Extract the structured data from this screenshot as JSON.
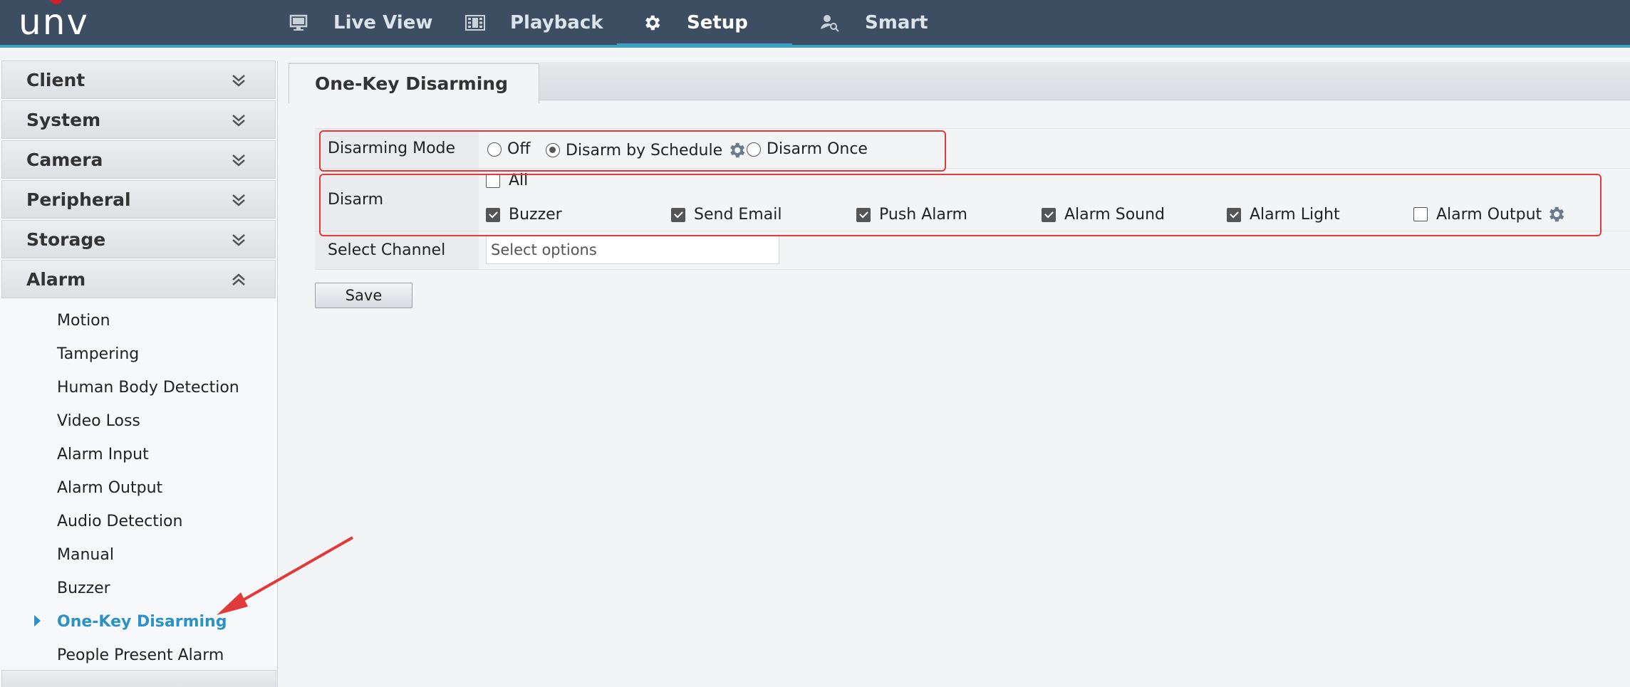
{
  "header": {
    "logo": "unv",
    "nav": [
      {
        "label": "Live View",
        "icon": "monitor-icon"
      },
      {
        "label": "Playback",
        "icon": "film-icon"
      },
      {
        "label": "Setup",
        "icon": "gear-icon",
        "active": true
      },
      {
        "label": "Smart",
        "icon": "user-search-icon"
      }
    ]
  },
  "sidebar": {
    "sections": [
      "Client",
      "System",
      "Camera",
      "Peripheral",
      "Storage"
    ],
    "alarm": {
      "label": "Alarm",
      "items": [
        "Motion",
        "Tampering",
        "Human Body Detection",
        "Video Loss",
        "Alarm Input",
        "Alarm Output",
        "Audio Detection",
        "Manual",
        "Buzzer",
        "One-Key Disarming",
        "People Present Alarm"
      ],
      "active_item": "One-Key Disarming"
    }
  },
  "main": {
    "tab": "One-Key Disarming",
    "disarming_mode": {
      "label": "Disarming Mode",
      "options": [
        "Off",
        "Disarm by Schedule",
        "Disarm Once"
      ],
      "selected": "Disarm by Schedule"
    },
    "disarm": {
      "label": "Disarm",
      "all_label": "All",
      "all_checked": false,
      "options": [
        {
          "label": "Buzzer",
          "checked": true
        },
        {
          "label": "Send Email",
          "checked": true
        },
        {
          "label": "Push Alarm",
          "checked": true
        },
        {
          "label": "Alarm Sound",
          "checked": true
        },
        {
          "label": "Alarm Light",
          "checked": true
        },
        {
          "label": "Alarm Output",
          "checked": false
        }
      ]
    },
    "select_channel": {
      "label": "Select Channel",
      "placeholder": "Select options"
    },
    "save_label": "Save"
  },
  "colors": {
    "header_bg": "#3e4e62",
    "accent": "#3aa0c7",
    "annotation_red": "#e23a3a"
  }
}
